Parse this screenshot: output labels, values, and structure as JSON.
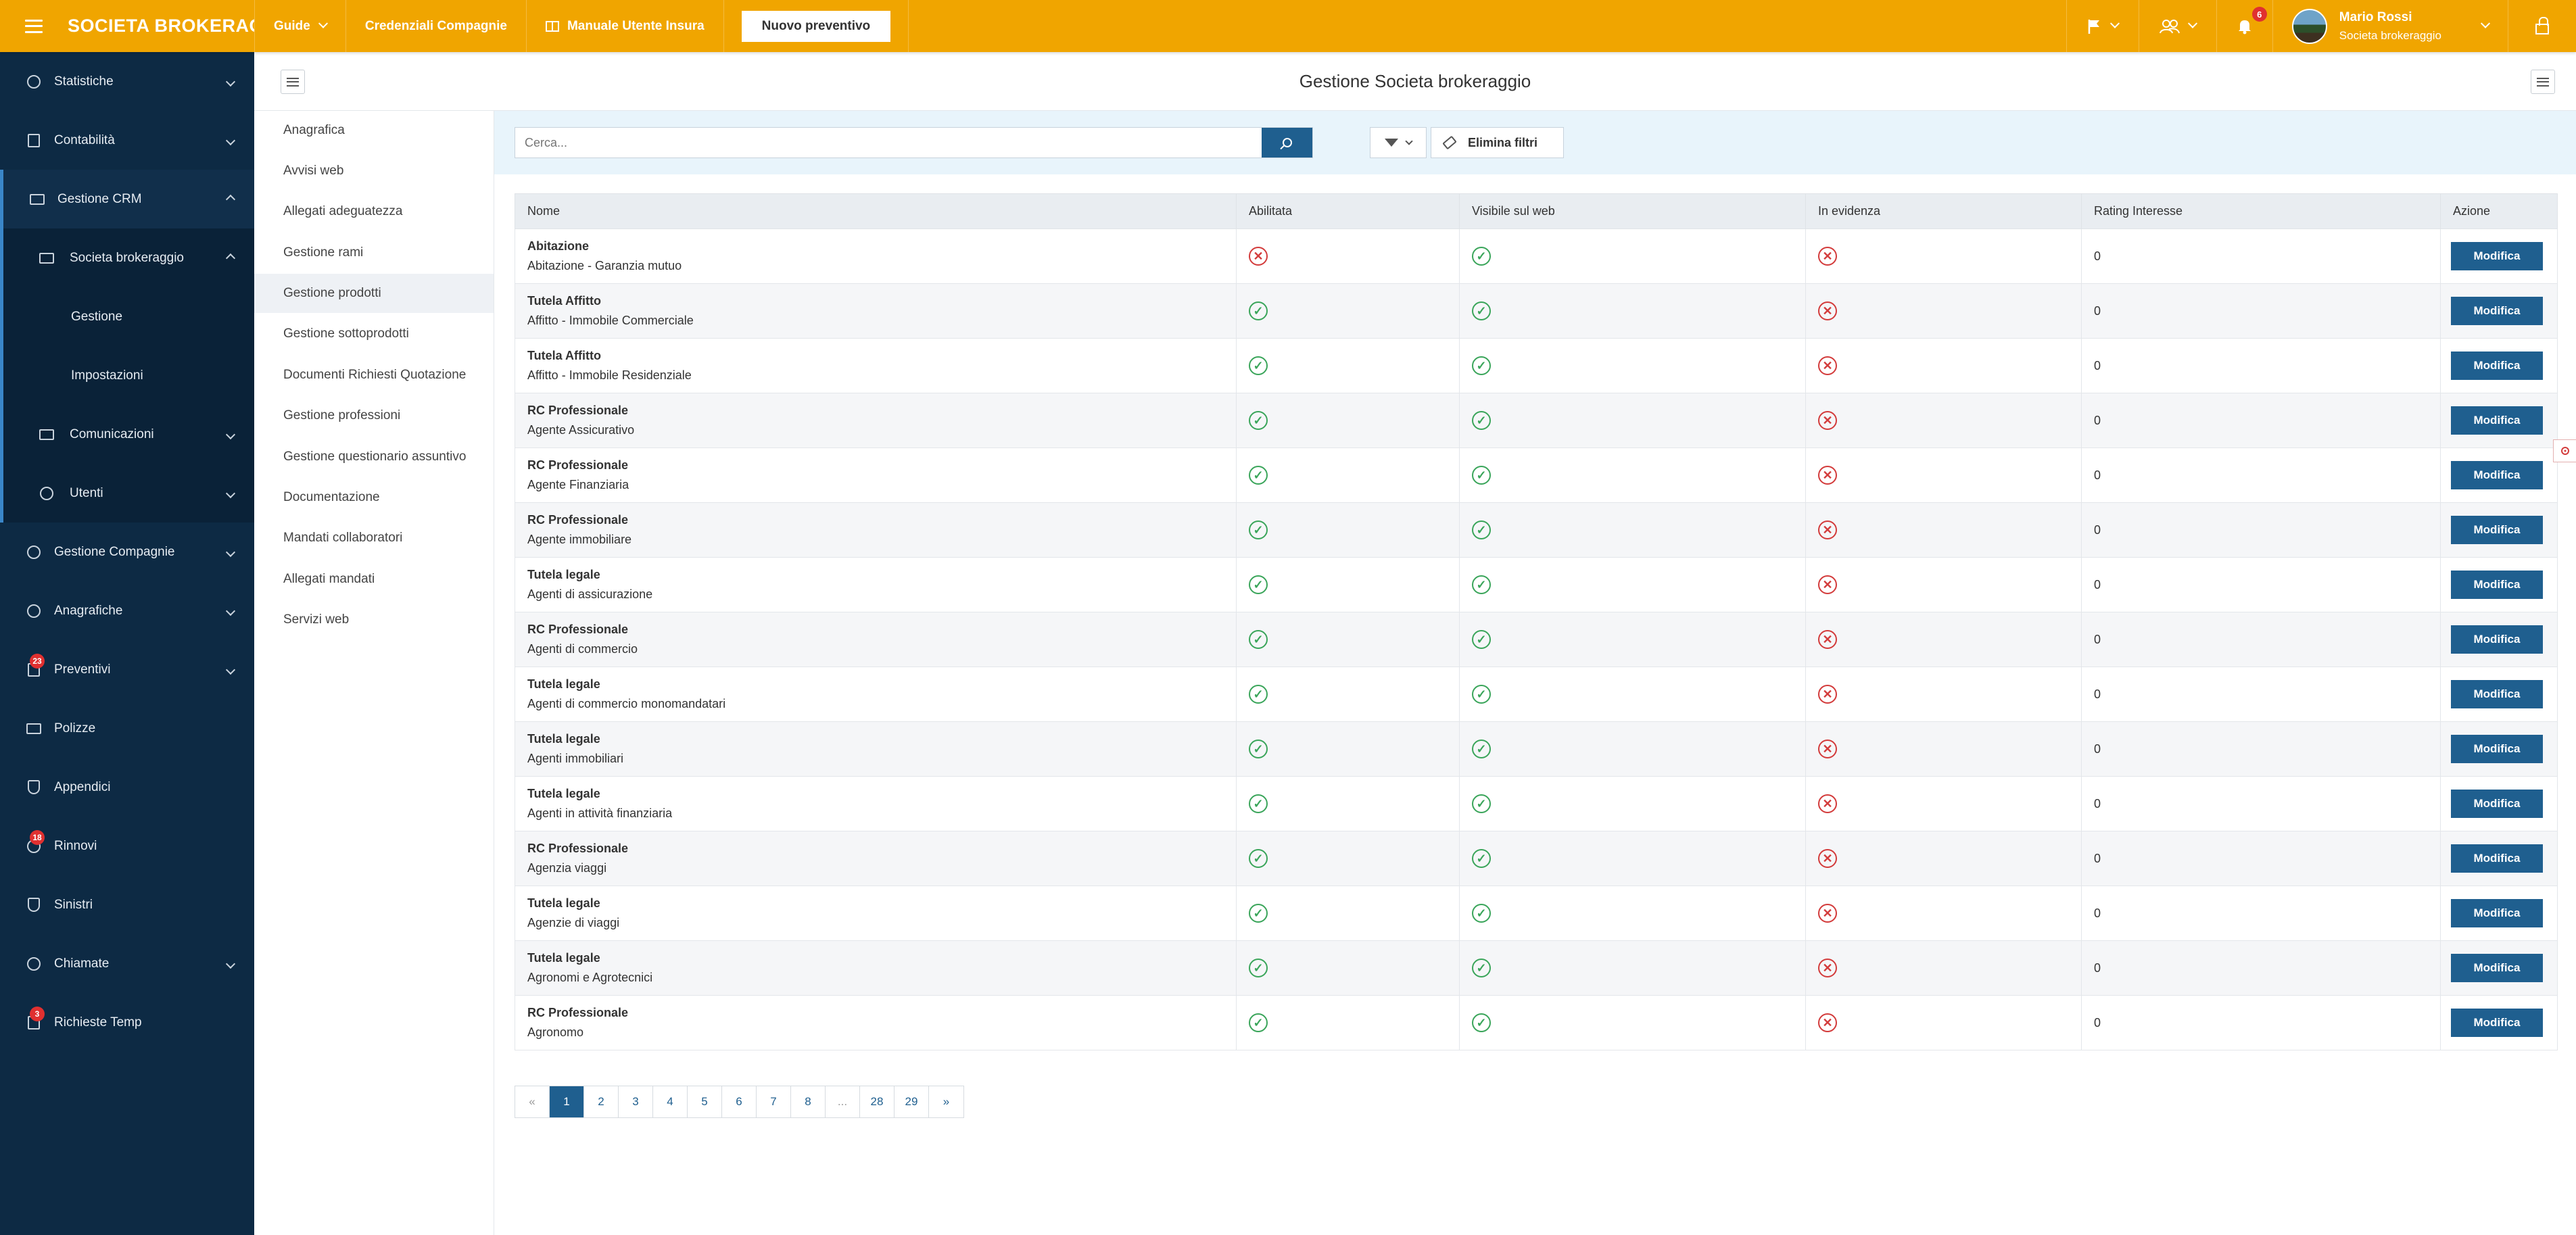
{
  "topbar": {
    "brand": "SOCIETA BROKERAG...",
    "nav": [
      {
        "label": "Guide",
        "has_dropdown": true
      },
      {
        "label": "Credenziali Compagnie",
        "has_dropdown": false
      },
      {
        "label": "Manuale Utente Insura",
        "has_dropdown": false,
        "icon": "book-icon"
      }
    ],
    "new_quote_label": "Nuovo preventivo",
    "notifications_count": "6",
    "user_name": "Mario Rossi",
    "user_company": "Societa brokeraggio"
  },
  "sidebar": {
    "items": [
      {
        "label": "Statistiche",
        "icon": "dashboard-icon"
      },
      {
        "label": "Contabilità",
        "icon": "calculator-icon"
      },
      {
        "label": "Gestione CRM",
        "icon": "building-icon",
        "expanded": true
      },
      {
        "label": "Societa brokeraggio",
        "icon": "building-icon",
        "expanded": true
      },
      {
        "label": "Gestione"
      },
      {
        "label": "Impostazioni"
      },
      {
        "label": "Comunicazioni",
        "icon": "megaphone-icon"
      },
      {
        "label": "Utenti",
        "icon": "users-icon"
      },
      {
        "label": "Gestione Compagnie",
        "icon": "globe-icon"
      },
      {
        "label": "Anagrafiche",
        "icon": "users-icon"
      },
      {
        "label": "Preventivi",
        "icon": "document-icon",
        "badge": "23"
      },
      {
        "label": "Polizze",
        "icon": "briefcase-icon"
      },
      {
        "label": "Appendici",
        "icon": "paperclip-icon"
      },
      {
        "label": "Rinnovi",
        "icon": "refresh-icon",
        "badge": "18"
      },
      {
        "label": "Sinistri",
        "icon": "shield-icon"
      },
      {
        "label": "Chiamate",
        "icon": "headset-icon"
      },
      {
        "label": "Richieste Temp",
        "icon": "inbox-icon",
        "badge": "3"
      }
    ]
  },
  "page": {
    "title": "Gestione Societa brokeraggio"
  },
  "submenu": [
    "Anagrafica",
    "Avvisi web",
    "Allegati adeguatezza",
    "Gestione rami",
    "Gestione prodotti",
    "Gestione sottoprodotti",
    "Documenti Richiesti Quotazione",
    "Gestione professioni",
    "Gestione questionario assuntivo",
    "Documentazione",
    "Mandati collaboratori",
    "Allegati mandati",
    "Servizi web"
  ],
  "submenu_active": "Gestione prodotti",
  "filters": {
    "search_placeholder": "Cerca...",
    "clear_label": "Elimina filtri"
  },
  "table": {
    "columns": [
      "Nome",
      "Abilitata",
      "Visibile sul web",
      "In evidenza",
      "Rating Interesse",
      "Azione"
    ],
    "action_label": "Modifica",
    "rows": [
      {
        "title": "Abitazione",
        "sub": "Abitazione - Garanzia mutuo",
        "abilitata": false,
        "visibile": true,
        "evidenza": false,
        "rating": "0"
      },
      {
        "title": "Tutela Affitto",
        "sub": "Affitto - Immobile Commerciale",
        "abilitata": true,
        "visibile": true,
        "evidenza": false,
        "rating": "0"
      },
      {
        "title": "Tutela Affitto",
        "sub": "Affitto - Immobile Residenziale",
        "abilitata": true,
        "visibile": true,
        "evidenza": false,
        "rating": "0"
      },
      {
        "title": "RC Professionale",
        "sub": "Agente Assicurativo",
        "abilitata": true,
        "visibile": true,
        "evidenza": false,
        "rating": "0"
      },
      {
        "title": "RC Professionale",
        "sub": "Agente Finanziaria",
        "abilitata": true,
        "visibile": true,
        "evidenza": false,
        "rating": "0"
      },
      {
        "title": "RC Professionale",
        "sub": "Agente immobiliare",
        "abilitata": true,
        "visibile": true,
        "evidenza": false,
        "rating": "0"
      },
      {
        "title": "Tutela legale",
        "sub": "Agenti di assicurazione",
        "abilitata": true,
        "visibile": true,
        "evidenza": false,
        "rating": "0"
      },
      {
        "title": "RC Professionale",
        "sub": "Agenti di commercio",
        "abilitata": true,
        "visibile": true,
        "evidenza": false,
        "rating": "0"
      },
      {
        "title": "Tutela legale",
        "sub": "Agenti di commercio monomandatari",
        "abilitata": true,
        "visibile": true,
        "evidenza": false,
        "rating": "0"
      },
      {
        "title": "Tutela legale",
        "sub": "Agenti immobiliari",
        "abilitata": true,
        "visibile": true,
        "evidenza": false,
        "rating": "0"
      },
      {
        "title": "Tutela legale",
        "sub": "Agenti in attività finanziaria",
        "abilitata": true,
        "visibile": true,
        "evidenza": false,
        "rating": "0"
      },
      {
        "title": "RC Professionale",
        "sub": "Agenzia viaggi",
        "abilitata": true,
        "visibile": true,
        "evidenza": false,
        "rating": "0"
      },
      {
        "title": "Tutela legale",
        "sub": "Agenzie di viaggi",
        "abilitata": true,
        "visibile": true,
        "evidenza": false,
        "rating": "0"
      },
      {
        "title": "Tutela legale",
        "sub": "Agronomi e Agrotecnici",
        "abilitata": true,
        "visibile": true,
        "evidenza": false,
        "rating": "0"
      },
      {
        "title": "RC Professionale",
        "sub": "Agronomo",
        "abilitata": true,
        "visibile": true,
        "evidenza": false,
        "rating": "0"
      }
    ]
  },
  "pagination": {
    "pages": [
      "«",
      "1",
      "2",
      "3",
      "4",
      "5",
      "6",
      "7",
      "8",
      "...",
      "28",
      "29",
      "»"
    ],
    "current": "1"
  },
  "colors": {
    "topbar": "#f0a500",
    "sidebar": "#0d2a44",
    "primary": "#1f5f8f",
    "ok": "#3aa55a",
    "no": "#d33b3b"
  }
}
